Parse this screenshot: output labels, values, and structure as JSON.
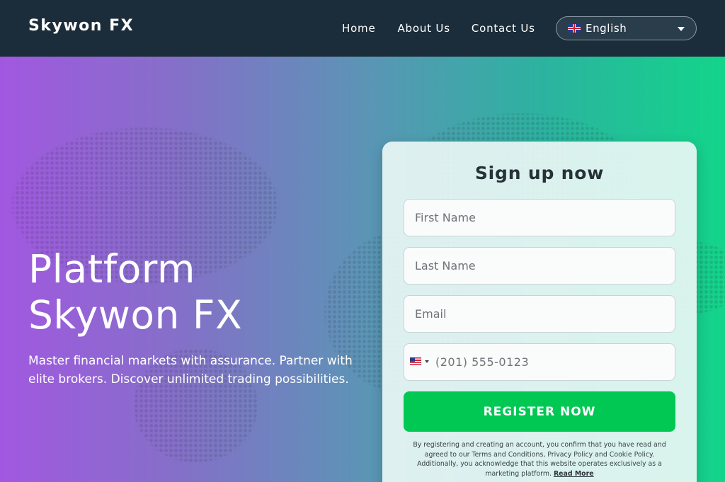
{
  "navbar": {
    "brand": "Skywon FX",
    "links": [
      {
        "label": "Home"
      },
      {
        "label": "About Us"
      },
      {
        "label": "Contact Us"
      }
    ],
    "language": {
      "selected": "English",
      "flag_icon": "uk-flag-icon"
    }
  },
  "hero": {
    "title_line1": "Platform",
    "title_line2": "Skywon FX",
    "subtitle": "Master financial markets with assurance. Partner with elite brokers. Discover unlimited trading possibilities.",
    "gradient_colors": [
      "#a158e0",
      "#5c94b6",
      "#13d48a"
    ]
  },
  "signup": {
    "title": "Sign up now",
    "first_name_placeholder": "First Name",
    "last_name_placeholder": "Last Name",
    "email_placeholder": "Email",
    "phone_placeholder": "(201) 555-0123",
    "phone_country_icon": "us-flag-icon",
    "register_label": "REGISTER NOW",
    "register_color": "#00c853",
    "disclaimer": "By registering and creating an account, you confirm that you have read and agreed to our Terms and Conditions, Privacy Policy and Cookie Policy. Additionally, you acknowledge that this website operates exclusively as a marketing platform.",
    "read_more": "Read More"
  }
}
